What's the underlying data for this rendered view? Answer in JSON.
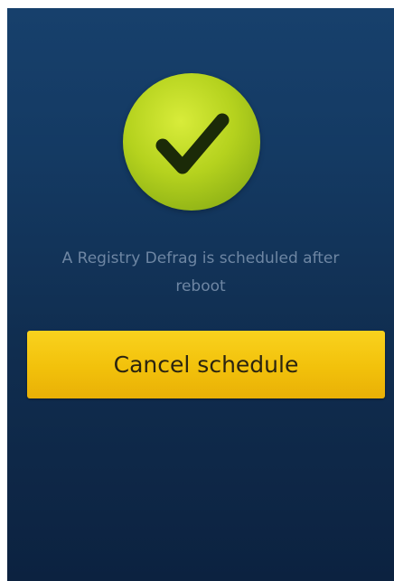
{
  "status": {
    "icon": "checkmark-icon",
    "message_line1": "A Registry Defrag is scheduled after",
    "message_line2": "reboot"
  },
  "actions": {
    "cancel_label": "Cancel schedule"
  },
  "colors": {
    "background_top": "#17406c",
    "background_bottom": "#0c2240",
    "check_green": "#b5d21e",
    "button_yellow": "#f2c10b",
    "message_text": "#6e86a3"
  }
}
